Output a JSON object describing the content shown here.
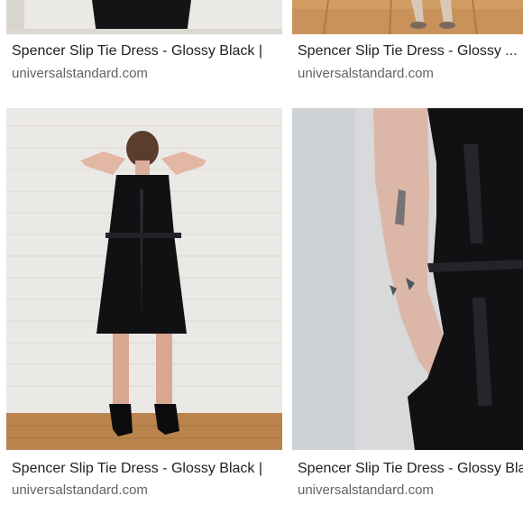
{
  "results": [
    {
      "title": "Spencer Slip Tie Dress - Glossy Black |",
      "source": "universalstandard.com"
    },
    {
      "title": "Spencer Slip Tie Dress - Glossy ...",
      "source": "universalstandard.com"
    },
    {
      "title": "Spencer Slip Tie Dress - Glossy Black |",
      "source": "universalstandard.com"
    },
    {
      "title": "Spencer Slip Tie Dress - Glossy Black |",
      "source": "universalstandard.com"
    }
  ],
  "colors": {
    "title": "#202124",
    "source": "#5f6368",
    "dress": "#111114",
    "wall": "#e9e7e3",
    "floor": "#b9844e"
  }
}
